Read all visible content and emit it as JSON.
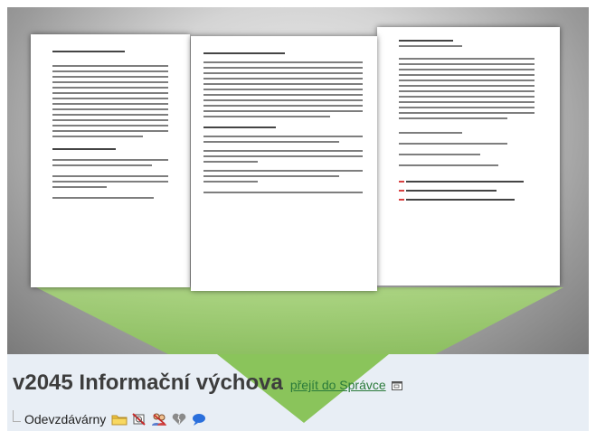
{
  "course": {
    "title": "v2045 Informační výchova",
    "manager_link": "přejít do Správce"
  },
  "folder": {
    "label": "Odevzdávárny"
  },
  "documents": [
    {
      "name": "document-left"
    },
    {
      "name": "document-center"
    },
    {
      "name": "document-right"
    }
  ],
  "icons": [
    "folder-icon",
    "no-access-icon",
    "users-icon",
    "heart-broken-icon",
    "comment-icon",
    "popup-window-icon"
  ],
  "colors": {
    "spotlight": "#8cc25a",
    "title": "#3d3d3d",
    "link": "#2a7a3a",
    "info_bar": "#e8eef5"
  }
}
